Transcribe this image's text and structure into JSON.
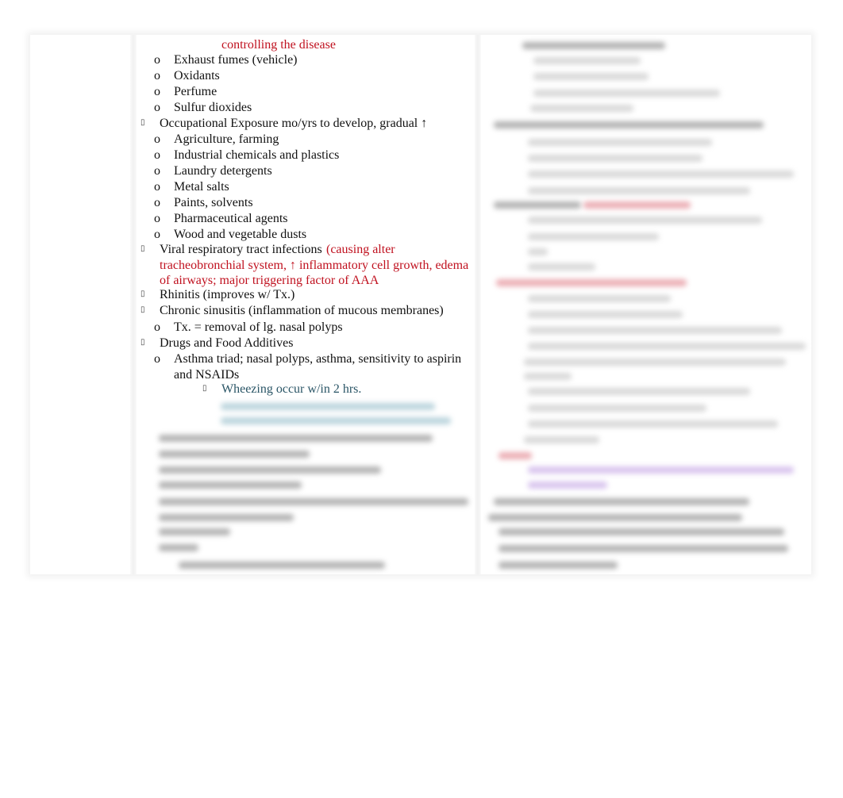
{
  "document": {
    "left_column": {
      "continuation_text": "controlling the disease",
      "irritant_items": [
        "Exhaust fumes (vehicle)",
        "Oxidants",
        " Perfume",
        "Sulfur dioxides"
      ],
      "occupational": {
        "heading": "Occupational Exposure mo/yrs to develop, gradual ↑",
        "items": [
          "Agriculture, farming",
          "Industrial chemicals and plastics",
          "Laundry detergents",
          "Metal salts",
          "Paints, solvents",
          " Pharmaceutical agents",
          "Wood and vegetable dusts"
        ]
      },
      "viral": {
        "heading": "Viral respiratory tract infections",
        "note_line1": "(causing alter",
        "note_line2": "tracheobronchial system, ↑ inflammatory cell growth, edema",
        "note_line3": "of airways; major triggering factor of AAA"
      },
      "rhinitis": "Rhinitis (improves w/ Tx.)",
      "sinusitis": {
        "heading": "Chronic sinusitis (inflammation of mucous membranes)",
        "items": [
          "Tx. = removal of lg. nasal polyps"
        ]
      },
      "drugs": {
        "heading": "Drugs and Food Additives",
        "triad_line1": "Asthma triad; nasal polyps, asthma, sensitivity to aspirin",
        "triad_line2": "and NSAIDs",
        "wheezing": "Wheezing occur w/in 2 hrs."
      }
    },
    "bullet_symbols": {
      "sub": "o",
      "main": "",
      "sub_sub": ""
    },
    "colors": {
      "emphasis_red": "#c0111f",
      "teal_note": "#2a5566",
      "body_text": "#111111"
    }
  }
}
